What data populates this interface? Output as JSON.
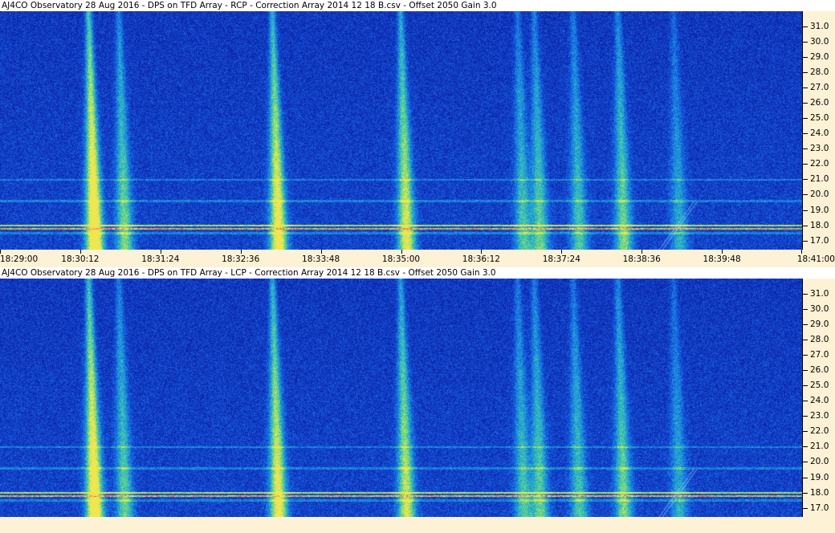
{
  "panels": [
    {
      "title": "AJ4CO Observatory 28 Aug 2016  -  DPS on TFD Array  -  RCP  -  Correction Array 2014 12 18 B.csv  -  Offset 2050  Gain 3.0"
    },
    {
      "title": "AJ4CO Observatory 28 Aug 2016  -  DPS on TFD Array  -  LCP  -  Correction Array 2014 12 18 B.csv  -  Offset 2050  Gain 3.0"
    }
  ],
  "colors": {
    "background": "#fdf2d6",
    "spectrogram_low": "#0a1f8a",
    "spectrogram_mid": "#1e78e0",
    "spectrogram_high": "#7fe08a"
  },
  "chart_data": [
    {
      "type": "heatmap",
      "polarization": "RCP",
      "x_tick_labels": [
        "18:29:00",
        "18:30:12",
        "18:31:24",
        "18:32:36",
        "18:33:48",
        "18:35:00",
        "18:36:12",
        "18:37:24",
        "18:38:36",
        "18:39:48",
        "18:41:00"
      ],
      "y_tick_labels": [
        "31.0",
        "30.0",
        "29.0",
        "28.0",
        "27.0",
        "26.0",
        "25.0",
        "24.0",
        "23.0",
        "22.0",
        "21.0",
        "20.0",
        "19.0",
        "18.0",
        "17.0"
      ],
      "x_range": [
        "18:29:00",
        "18:41:00"
      ],
      "y_range": [
        16.4,
        32.0
      ],
      "ylabel": "",
      "xlabel": "",
      "bursts": [
        {
          "time": "18:30:25",
          "intensity": 1.0
        },
        {
          "time": "18:30:52",
          "intensity": 0.55
        },
        {
          "time": "18:33:10",
          "intensity": 0.85
        },
        {
          "time": "18:35:05",
          "intensity": 0.75
        },
        {
          "time": "18:36:50",
          "intensity": 0.45
        },
        {
          "time": "18:37:05",
          "intensity": 0.5
        },
        {
          "time": "18:37:40",
          "intensity": 0.45
        },
        {
          "time": "18:38:20",
          "intensity": 0.55
        },
        {
          "time": "18:39:10",
          "intensity": 0.35
        }
      ],
      "interference_freqs": [
        17.8,
        18.0,
        17.5,
        21.0,
        19.6
      ]
    },
    {
      "type": "heatmap",
      "polarization": "LCP",
      "x_tick_labels": [],
      "y_tick_labels": [
        "31.0",
        "30.0",
        "29.0",
        "28.0",
        "27.0",
        "26.0",
        "25.0",
        "24.0",
        "23.0",
        "22.0",
        "21.0",
        "20.0",
        "19.0",
        "18.0",
        "17.0"
      ],
      "x_range": [
        "18:29:00",
        "18:41:00"
      ],
      "y_range": [
        16.4,
        32.0
      ],
      "ylabel": "",
      "xlabel": "",
      "bursts": [
        {
          "time": "18:30:25",
          "intensity": 0.95
        },
        {
          "time": "18:30:52",
          "intensity": 0.5
        },
        {
          "time": "18:33:10",
          "intensity": 0.8
        },
        {
          "time": "18:35:05",
          "intensity": 0.7
        },
        {
          "time": "18:36:50",
          "intensity": 0.45
        },
        {
          "time": "18:37:05",
          "intensity": 0.5
        },
        {
          "time": "18:37:40",
          "intensity": 0.45
        },
        {
          "time": "18:38:20",
          "intensity": 0.55
        },
        {
          "time": "18:39:10",
          "intensity": 0.35
        }
      ],
      "interference_freqs": [
        17.8,
        18.0,
        17.5,
        21.0,
        19.6
      ]
    }
  ]
}
